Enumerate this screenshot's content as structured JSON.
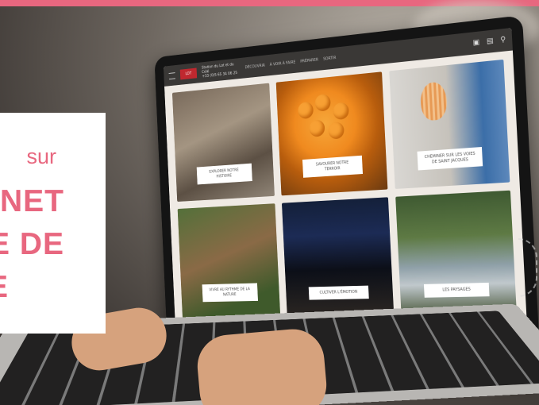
{
  "overlay": {
    "line_sur": "sur",
    "line_1": "NET",
    "line_2": "E DE",
    "line_3": "E"
  },
  "site": {
    "brand_line1": "Station du Lot et du Célé",
    "brand_line2": "+33 (0)5 65 34 06 25",
    "menu": [
      "DÉCOUVRIR",
      "À VOIR À FAIRE",
      "PRÉPARER",
      "SORTIR"
    ],
    "tiles": [
      {
        "caption": "EXPLORER NOTRE HISTOIRE"
      },
      {
        "caption": "SAVOURER NOTRE TERROIR"
      },
      {
        "caption": "CHEMINER SUR LES VOIES DE SAINT JACQUES"
      },
      {
        "caption": "VIVRE AU RYTHME DE LA NATURE"
      },
      {
        "caption": "CULTIVER L'ÉMOTION"
      },
      {
        "caption": "LES PAYSAGES"
      }
    ]
  },
  "colors": {
    "accent": "#e8677f",
    "nav": "#3a3836",
    "logo_red": "#c0282f"
  }
}
